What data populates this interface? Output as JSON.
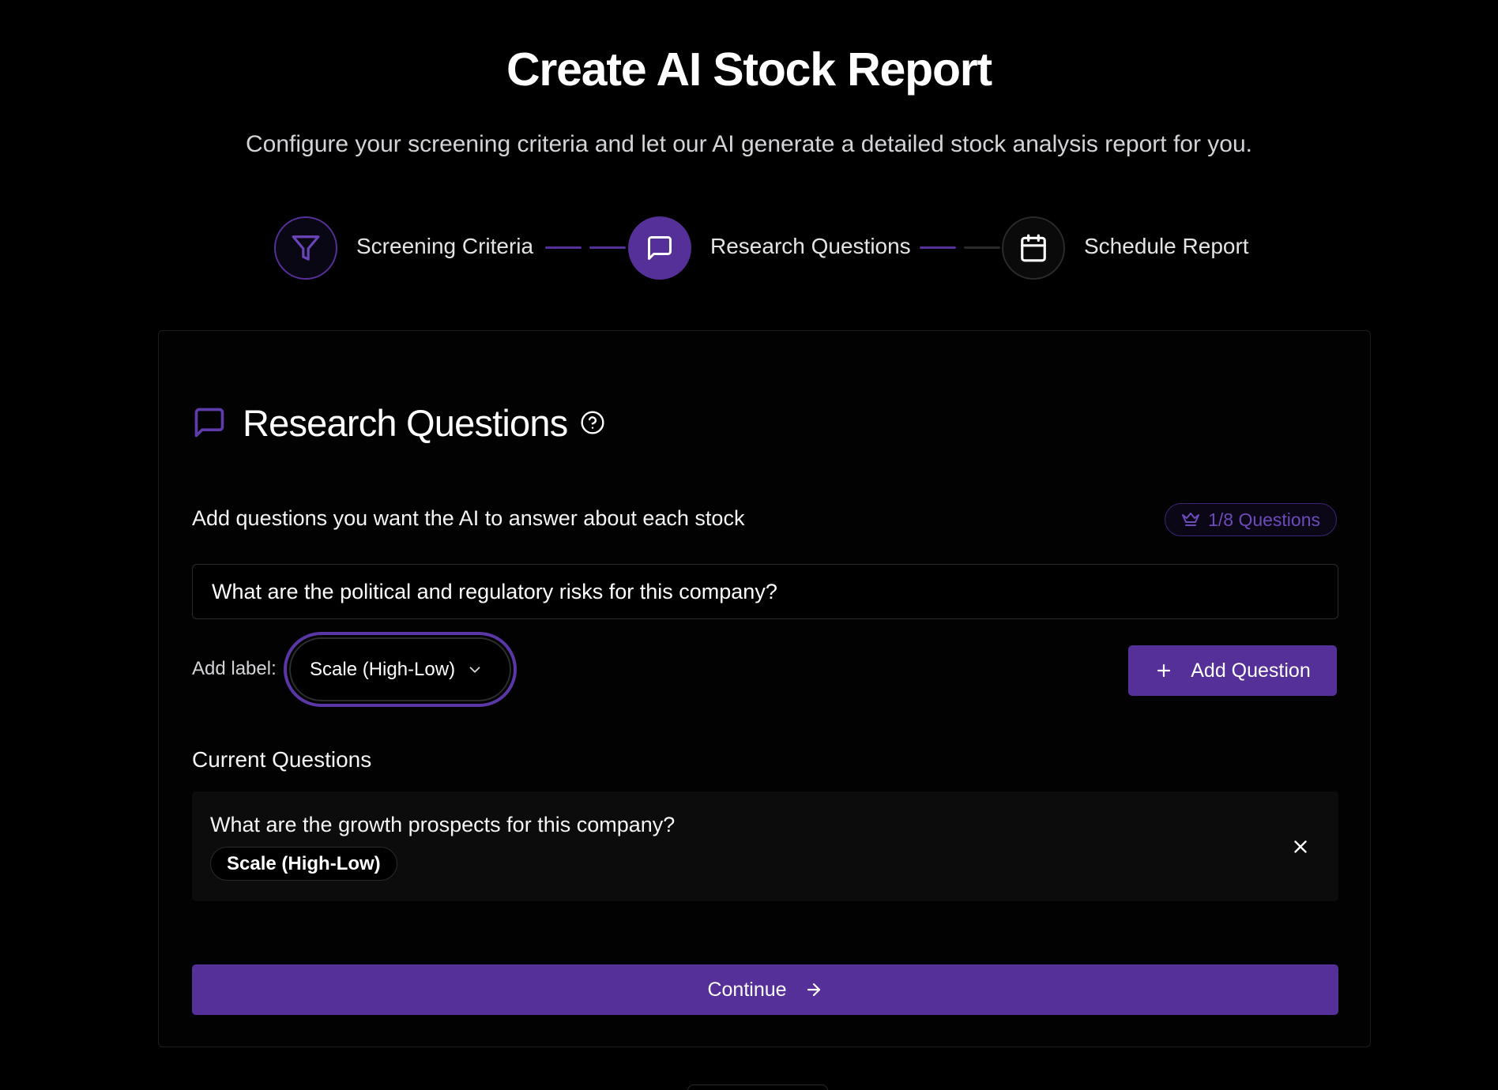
{
  "header": {
    "title": "Create AI Stock Report",
    "subtitle": "Configure your screening criteria and let our AI generate a detailed stock analysis report for you."
  },
  "stepper": {
    "steps": [
      {
        "label": "Screening Criteria",
        "status": "completed",
        "icon": "filter-icon"
      },
      {
        "label": "Research Questions",
        "status": "active",
        "icon": "message-square-icon"
      },
      {
        "label": "Schedule Report",
        "status": "pending",
        "icon": "calendar-icon"
      }
    ]
  },
  "section": {
    "icon": "message-square-icon",
    "title": "Research Questions",
    "help_icon": "help-circle-icon"
  },
  "form": {
    "instructions": "Add questions you want the AI to answer about each stock",
    "quota_icon": "crown-icon",
    "quota_label": "1/8 Questions",
    "question_value": "What are the political and regulatory risks for this company?",
    "add_label_text": "Add label:",
    "label_selected": "Scale (High-Low)",
    "add_button_label": "Add Question"
  },
  "current": {
    "title": "Current Questions",
    "items": [
      {
        "text": "What are the growth prospects for this company?",
        "tag": "Scale (High-Low)"
      }
    ]
  },
  "actions": {
    "continue_label": "Continue"
  },
  "colors": {
    "accent": "#553099",
    "background": "#000000",
    "card_border": "#1c1c1c",
    "badge_text": "#6d4bbb"
  }
}
